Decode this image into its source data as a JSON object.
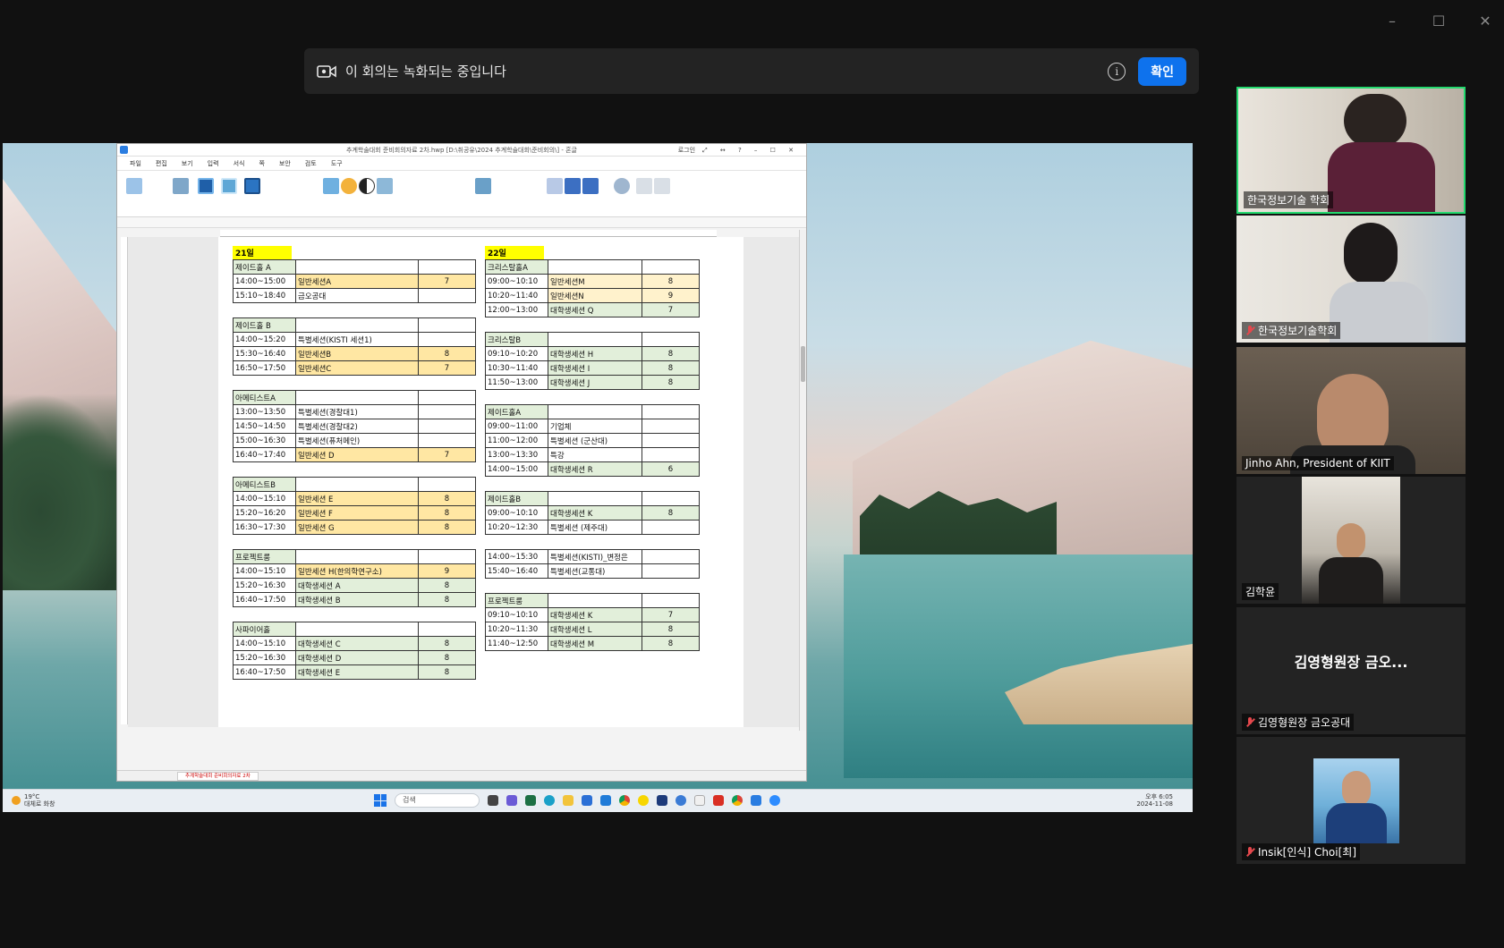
{
  "window": {
    "minimize": "–",
    "maximize": "☐",
    "close": "✕"
  },
  "banner": {
    "message": "이 회의는 녹화되는 중입니다",
    "info_icon": "i",
    "confirm": "확인"
  },
  "doc": {
    "title": "추계학술대회 준비회의자료 2차.hwp [D:\\취공유\\2024 추계학술대회\\준비회의\\] - 혼글",
    "login": "로그인",
    "menu": [
      "파일",
      "편집",
      "보기",
      "입력",
      "서식",
      "쪽",
      "보안",
      "검토",
      "도구"
    ],
    "tab_name": "추계학술대회 준비회의자료 2차"
  },
  "schedule": {
    "day21": {
      "label": "21일",
      "blocks": [
        {
          "room": "제이드홀 A",
          "rows": [
            {
              "time": "14:00~15:00",
              "session": "일반세션A",
              "count": "7",
              "color": "or"
            },
            {
              "time": "15:10~18:40",
              "session": "금오공대",
              "count": "",
              "color": ""
            }
          ]
        },
        {
          "room": "제이드홀 B",
          "rows": [
            {
              "time": "14:00~15:20",
              "session": "특별세션(KISTI 세션1)",
              "count": "",
              "color": ""
            },
            {
              "time": "15:30~16:40",
              "session": "일반세션B",
              "count": "8",
              "color": "or"
            },
            {
              "time": "16:50~17:50",
              "session": "일반세션C",
              "count": "7",
              "color": "or"
            }
          ]
        },
        {
          "room": "아메티스트A",
          "rows": [
            {
              "time": "13:00~13:50",
              "session": "특별세션(경찰대1)",
              "count": "",
              "color": ""
            },
            {
              "time": "14:50~14:50",
              "session": "특별세션(경찰대2)",
              "count": "",
              "color": ""
            },
            {
              "time": "15:00~16:30",
              "session": "특별세션(퓨처메인)",
              "count": "",
              "color": ""
            },
            {
              "time": "16:40~17:40",
              "session": "일반세션 D",
              "count": "7",
              "color": "or"
            }
          ]
        },
        {
          "room": "아메티스트B",
          "rows": [
            {
              "time": "14:00~15:10",
              "session": "일반세션 E",
              "count": "8",
              "color": "or"
            },
            {
              "time": "15:20~16:20",
              "session": "일반세션 F",
              "count": "8",
              "color": "or"
            },
            {
              "time": "16:30~17:30",
              "session": "일반세션 G",
              "count": "8",
              "color": "or"
            }
          ]
        },
        {
          "room": "프로젝트룸",
          "rows": [
            {
              "time": "14:00~15:10",
              "session": "일반세션 H(한의학연구소)",
              "count": "9",
              "color": "or"
            },
            {
              "time": "15:20~16:30",
              "session": "대학생세션 A",
              "count": "8",
              "color": "gr"
            },
            {
              "time": "16:40~17:50",
              "session": "대학생세션 B",
              "count": "8",
              "color": "gr"
            }
          ]
        },
        {
          "room": "사파이어홀",
          "rows": [
            {
              "time": "14:00~15:10",
              "session": "대학생세션 C",
              "count": "8",
              "color": "gr"
            },
            {
              "time": "15:20~16:30",
              "session": "대학생세션 D",
              "count": "8",
              "color": "gr"
            },
            {
              "time": "16:40~17:50",
              "session": "대학생세션 E",
              "count": "8",
              "color": "gr"
            }
          ]
        }
      ]
    },
    "day22": {
      "label": "22일",
      "blocks": [
        {
          "room": "크리스탈홀A",
          "rows": [
            {
              "time": "09:00~10:10",
              "session": "일반세션M",
              "count": "8",
              "color": "lo"
            },
            {
              "time": "10:20~11:40",
              "session": "일반세션N",
              "count": "9",
              "color": "lo"
            },
            {
              "time": "12:00~13:00",
              "session": "대학생세션 Q",
              "count": "7",
              "color": "gr"
            }
          ]
        },
        {
          "room": "크리스탈B",
          "rows": [
            {
              "time": "09:10~10:20",
              "session": "대학생세션 H",
              "count": "8",
              "color": "gr"
            },
            {
              "time": "10:30~11:40",
              "session": "대학생세션 I",
              "count": "8",
              "color": "gr"
            },
            {
              "time": "11:50~13:00",
              "session": "대학생세션 J",
              "count": "8",
              "color": "gr"
            }
          ]
        },
        {
          "room": "제이드홀A",
          "rows": [
            {
              "time": "09:00~11:00",
              "session": "기업체",
              "count": "",
              "color": ""
            },
            {
              "time": "11:00~12:00",
              "session": "특별세션 (군산대)",
              "count": "",
              "color": ""
            },
            {
              "time": "13:00~13:30",
              "session": "특강",
              "count": "",
              "color": ""
            },
            {
              "time": "14:00~15:00",
              "session": "대학생세션 R",
              "count": "6",
              "color": "gr"
            }
          ]
        },
        {
          "room": "제이드홀B",
          "rows": [
            {
              "time": "09:00~10:10",
              "session": "대학생세션 K",
              "count": "8",
              "color": "gr"
            },
            {
              "time": "10:20~12:30",
              "session": "특별세션 (제주대)",
              "count": "",
              "color": ""
            }
          ]
        },
        {
          "room": "",
          "rows": [
            {
              "time": "14:00~15:30",
              "session": "특별세션(KISTI)_변정은",
              "count": "",
              "color": ""
            },
            {
              "time": "15:40~16:40",
              "session": "특별세션(교통대)",
              "count": "",
              "color": ""
            }
          ]
        },
        {
          "room": "프로젝트룸",
          "rows": [
            {
              "time": "09:10~10:10",
              "session": "대학생세션 K",
              "count": "7",
              "color": "gr"
            },
            {
              "time": "10:20~11:30",
              "session": "대학생세션 L",
              "count": "8",
              "color": "gr"
            },
            {
              "time": "11:40~12:50",
              "session": "대학생세션 M",
              "count": "8",
              "color": "gr"
            }
          ]
        }
      ]
    }
  },
  "taskbar": {
    "weather": "19°C",
    "weather_sub": "대체로 화창",
    "search": "검색",
    "time": "오후 6:05",
    "date": "2024-11-08"
  },
  "participants": [
    {
      "name": "한국정보기술 학회",
      "muted": false,
      "active": true
    },
    {
      "name": "한국정보기술학회",
      "muted": true,
      "active": false
    },
    {
      "name": "Jinho Ahn, President of KIIT",
      "muted": false,
      "active": false
    },
    {
      "name": "김학윤",
      "muted": false,
      "active": false
    },
    {
      "name": "김영형원장 금오공대",
      "display": "김영형원장 금오...",
      "muted": true,
      "active": false
    },
    {
      "name": "Insik[인식] Choi[최]",
      "muted": true,
      "active": false
    }
  ]
}
